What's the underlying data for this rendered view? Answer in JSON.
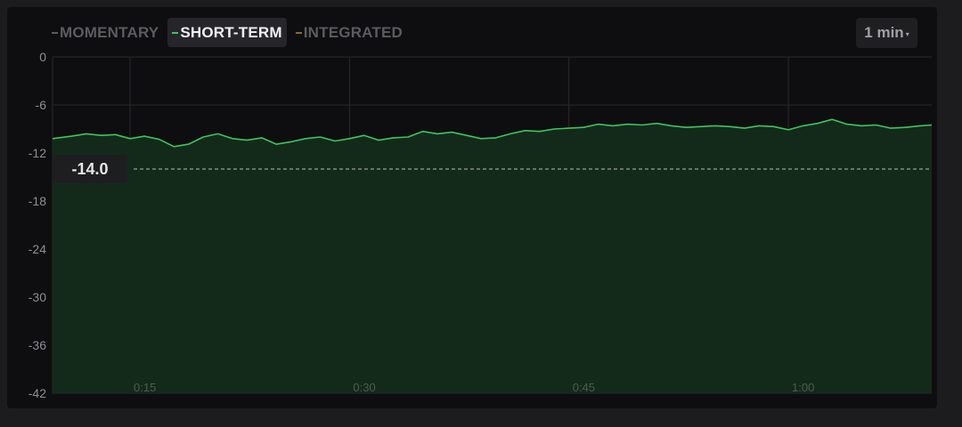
{
  "tabs": [
    {
      "label": "MOMENTARY",
      "active": false
    },
    {
      "label": "SHORT-TERM",
      "active": true
    },
    {
      "label": "INTEGRATED",
      "active": false
    }
  ],
  "range_selector": {
    "label": "1 min",
    "caret": "▾"
  },
  "target": {
    "label": "-14.0"
  },
  "colors": {
    "short_term_line": "#3ec45c",
    "short_term_fill": "#132a1b",
    "grid": "#2a2a2e",
    "target_line": "#9a9a9e"
  },
  "chart_data": {
    "type": "area",
    "series": [
      {
        "name": "SHORT-TERM",
        "x": [
          9.7,
          11,
          12,
          13,
          14,
          15,
          16,
          17,
          18,
          19,
          20,
          21,
          22,
          23,
          24,
          25,
          26,
          27,
          28,
          29,
          30,
          31,
          32,
          33,
          34,
          35,
          36,
          37,
          38,
          39,
          40,
          41,
          42,
          43,
          44,
          45,
          46,
          47,
          48,
          49,
          50,
          51,
          52,
          53,
          54,
          55,
          56,
          57,
          58,
          59,
          60,
          61,
          62,
          63,
          64,
          65,
          66,
          67,
          68,
          69,
          69.8
        ],
        "y": [
          -10.2,
          -9.9,
          -9.6,
          -9.8,
          -9.7,
          -10.2,
          -9.9,
          -10.3,
          -11.2,
          -10.9,
          -10.0,
          -9.6,
          -10.2,
          -10.4,
          -10.1,
          -10.9,
          -10.6,
          -10.2,
          -10.0,
          -10.5,
          -10.2,
          -9.8,
          -10.4,
          -10.1,
          -10.0,
          -9.3,
          -9.6,
          -9.4,
          -9.8,
          -10.2,
          -10.1,
          -9.6,
          -9.2,
          -9.3,
          -9.0,
          -8.9,
          -8.8,
          -8.4,
          -8.6,
          -8.4,
          -8.5,
          -8.3,
          -8.6,
          -8.8,
          -8.7,
          -8.6,
          -8.7,
          -8.9,
          -8.6,
          -8.7,
          -9.1,
          -8.6,
          -8.3,
          -7.8,
          -8.4,
          -8.6,
          -8.5,
          -8.9,
          -8.8,
          -8.6,
          -8.5
        ]
      }
    ],
    "x_ticks": [
      {
        "value": 15,
        "label": "0:15"
      },
      {
        "value": 30,
        "label": "0:30"
      },
      {
        "value": 45,
        "label": "0:45"
      },
      {
        "value": 60,
        "label": "1:00"
      }
    ],
    "y_ticks": [
      0,
      -6,
      -12,
      -18,
      -24,
      -30,
      -36,
      -42
    ],
    "xlim": [
      9.7,
      69.8
    ],
    "ylim": [
      -42,
      0
    ],
    "target_value": -14.0,
    "grid": true,
    "title": "",
    "xlabel": "",
    "ylabel": ""
  }
}
